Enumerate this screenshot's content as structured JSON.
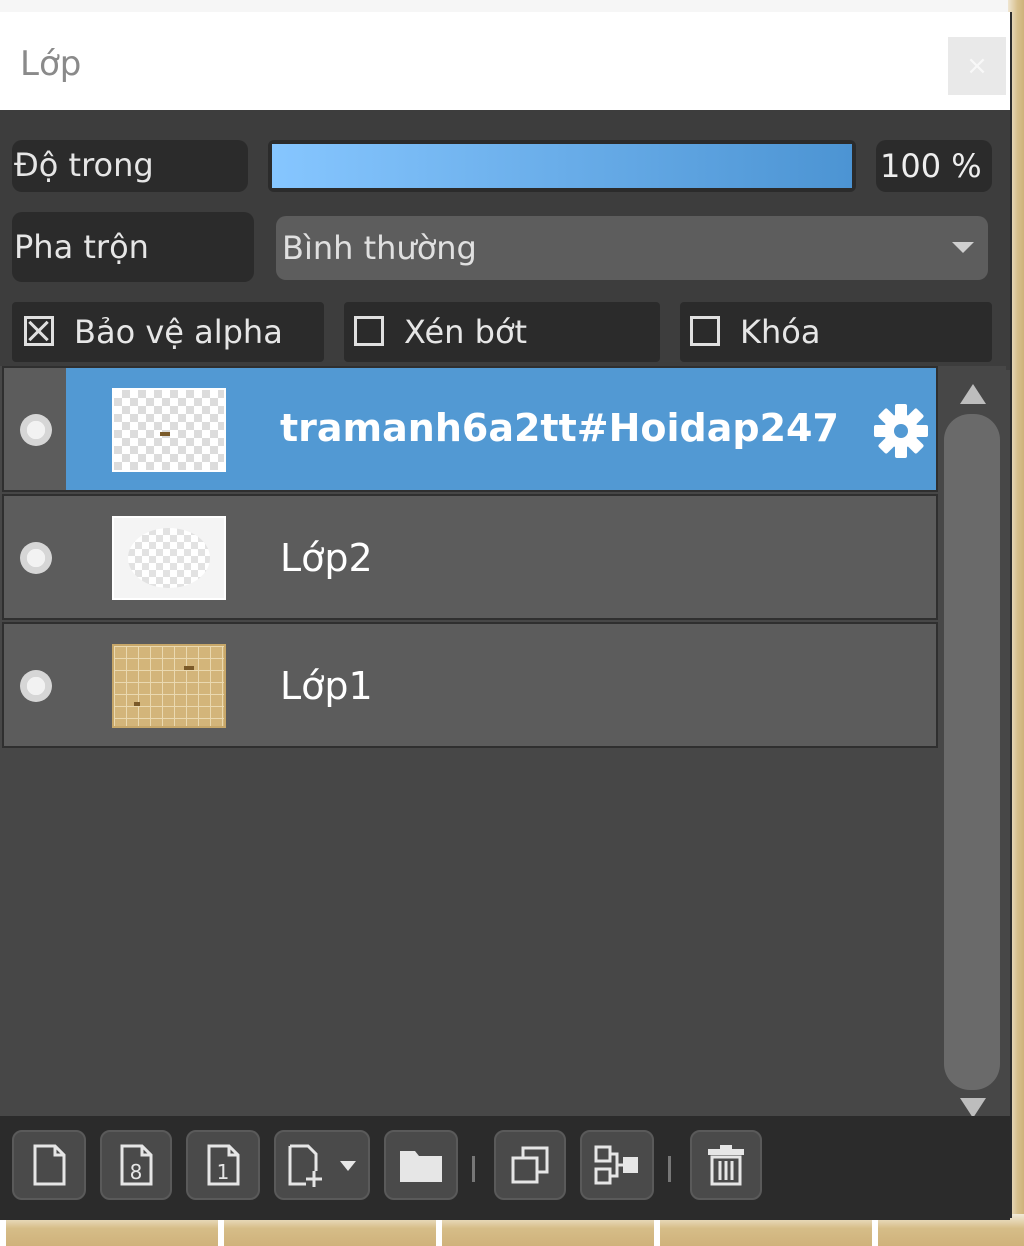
{
  "panel": {
    "title": "Lớp",
    "close_label": "×"
  },
  "opacity": {
    "label": "Độ trong",
    "value_text": "100 %",
    "value": 1.0
  },
  "blend": {
    "label": "Pha trộn",
    "selected": "Bình thường"
  },
  "options": [
    {
      "label": "Bảo vệ alpha",
      "checked": true
    },
    {
      "label": "Xén bớt",
      "checked": false
    },
    {
      "label": "Khóa",
      "checked": false
    }
  ],
  "layers": [
    {
      "name": "tramanh6a2tt#Hoidap247",
      "selected": true
    },
    {
      "name": "Lớp2",
      "selected": false
    },
    {
      "name": "Lớp1",
      "selected": false
    }
  ],
  "toolbar": {
    "buttons": [
      "new-layer-icon",
      "layer-8-icon",
      "layer-1-icon",
      "add-layer-icon",
      "folder-icon",
      "duplicate-icon",
      "merge-icon",
      "trash-icon"
    ]
  }
}
